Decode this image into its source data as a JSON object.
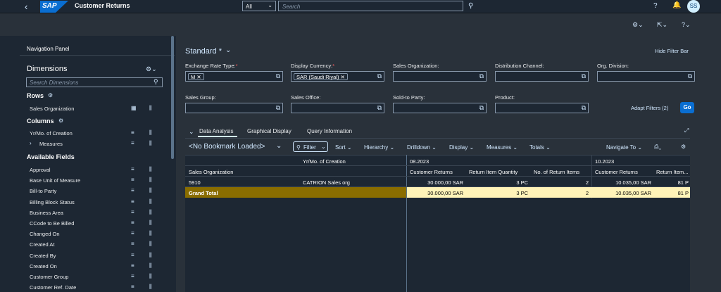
{
  "shell": {
    "back": "‹",
    "logo": "SAP",
    "title": "Customer Returns",
    "scope": "All",
    "search_placeholder": "Search",
    "avatar": "SS"
  },
  "nav": {
    "title": "Navigation Panel",
    "dimensions": "Dimensions",
    "search_placeholder": "Search Dimensions",
    "rows_label": "Rows",
    "rows": [
      "Sales Organization"
    ],
    "columns_label": "Columns",
    "columns": [
      "Yr/Mo. of Creation",
      "Measures"
    ],
    "available_label": "Available Fields",
    "fields": [
      "Approval",
      "Base Unit of Measure",
      "Bill-to Party",
      "Billing Block Status",
      "Business Area",
      "CCode to Be Billed",
      "Changed On",
      "Created At",
      "Created By",
      "Created On",
      "Customer Group",
      "Customer Ref. Date"
    ]
  },
  "filterbar": {
    "variant": "Standard *",
    "hide": "Hide Filter Bar",
    "exchange_label": "Exchange Rate Type:",
    "exchange_token": "M",
    "currency_label": "Display Currency:",
    "currency_token": "SAR (Saudi Riyal)",
    "salesorg_label": "Sales Organization:",
    "distch_label": "Distribution Channel:",
    "orgdiv_label": "Org. Division:",
    "salesgroup_label": "Sales Group:",
    "salesoffice_label": "Sales Office:",
    "soldto_label": "Sold-to Party:",
    "product_label": "Product:",
    "adapt": "Adapt Filters (2)",
    "go": "Go"
  },
  "tabs": [
    "Data Analysis",
    "Graphical Display",
    "Query Information"
  ],
  "toolbar": {
    "bookmark": "<No Bookmark Loaded>",
    "filter": "Filter",
    "sort": "Sort",
    "hierarchy": "Hierarchy",
    "drilldown": "Drilldown",
    "display": "Display",
    "measures": "Measures",
    "totals": "Totals",
    "navigate": "Navigate To"
  },
  "table": {
    "col_dim_label": "Yr/Mo. of Creation",
    "row_dim_label": "Sales Organization",
    "period1": "08.2023",
    "period2": "10.2023",
    "headers": [
      "Customer Returns",
      "Return Item Quantity",
      "No. of Return Items",
      "Customer Returns",
      "Return Item..."
    ],
    "row1": {
      "id": "5910",
      "name": "CATRION Sales org",
      "v1": "30.000,00 SAR",
      "v2": "3 PC",
      "v3": "2",
      "v4": "10.035,00 SAR",
      "v5": "81 P"
    },
    "total": {
      "label": "Grand Total",
      "v1": "30.000,00 SAR",
      "v2": "3 PC",
      "v3": "2",
      "v4": "10.035,00 SAR",
      "v5": "81 P"
    }
  },
  "colors": {
    "accent": "#0a6ed1",
    "total_row": "#8a6d00",
    "total_cells": "#fff3b8"
  }
}
